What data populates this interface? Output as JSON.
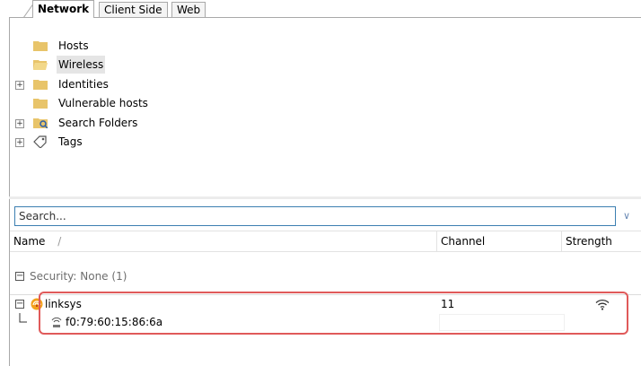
{
  "tabs": [
    {
      "label": "Network"
    },
    {
      "label": "Client Side"
    },
    {
      "label": "Web"
    }
  ],
  "tree": {
    "items": [
      {
        "label": "Hosts",
        "icon": "folder-icon",
        "expandable": false
      },
      {
        "label": "Wireless",
        "icon": "folder-open-icon",
        "expandable": false,
        "selected": true
      },
      {
        "label": "Identities",
        "icon": "folder-icon",
        "expandable": true
      },
      {
        "label": "Vulnerable hosts",
        "icon": "folder-icon",
        "expandable": false
      },
      {
        "label": "Search Folders",
        "icon": "search-folder-icon",
        "expandable": true
      },
      {
        "label": "Tags",
        "icon": "tag-icon",
        "expandable": true
      }
    ]
  },
  "search": {
    "placeholder": "Search...",
    "value": ""
  },
  "table": {
    "columns": [
      {
        "label": "Name",
        "sort_indicator": "/"
      },
      {
        "label": "Channel"
      },
      {
        "label": "Strength"
      }
    ],
    "group": {
      "label": "Security: None (1)",
      "collapse_symbol": "−"
    },
    "rows": [
      {
        "name": "linksys",
        "channel": "11",
        "strength_icon": "wifi-signal-icon",
        "icon": "access-point-icon"
      },
      {
        "name": "f0:79:60:15:86:6a",
        "channel": "",
        "icon": "wireless-client-icon",
        "child": true
      }
    ]
  },
  "colors": {
    "accent": "#3c7fb1",
    "highlight": "#e05a5a",
    "folder": "#e8c46a"
  }
}
